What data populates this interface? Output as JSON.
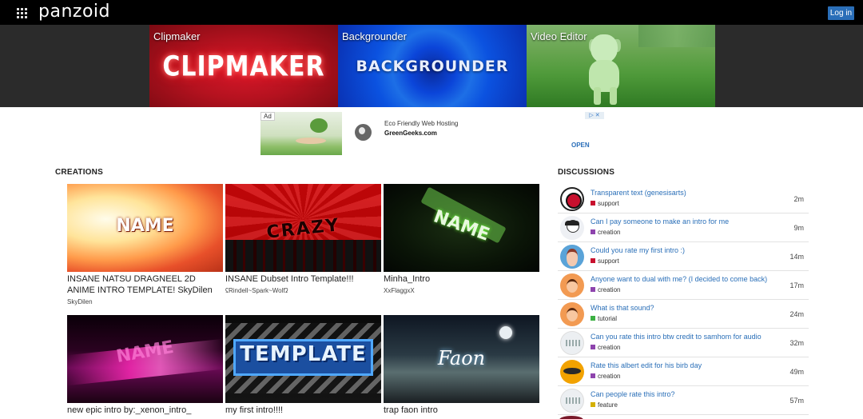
{
  "header": {
    "logo": "panzoid",
    "login_label": "Log in"
  },
  "hero": {
    "tiles": [
      {
        "label": "Clipmaker",
        "art_text": "CLIPMAKER"
      },
      {
        "label": "Backgrounder",
        "art_text": "BACKGROUNDER"
      },
      {
        "label": "Video Editor"
      }
    ]
  },
  "ad": {
    "badge": "Ad",
    "title": "Eco Friendly Web Hosting",
    "domain": "GreenGeeks.com",
    "cta": "OPEN",
    "choices": "▷ ✕"
  },
  "creations": {
    "heading": "CREATIONS",
    "items": [
      {
        "title": "INSANE NATSU DRAGNEEL 2D ANIME INTRO TEMPLATE! SkyDilen",
        "author": "SkyDilen",
        "art_text": "NAME"
      },
      {
        "title": "INSANE Dubset Intro Template!!!",
        "author": "ʢRindell~Spark~Wolfʡ",
        "art_text": "CRAZY"
      },
      {
        "title": "Minha_Intro",
        "author": "XxFlaggxX",
        "art_text": "NAME"
      },
      {
        "title": "new epic intro by:_xenon_intro_",
        "author": "",
        "art_text": "NAME"
      },
      {
        "title": "my first intro!!!!",
        "author": "",
        "art_text": "TEMPLATE"
      },
      {
        "title": "trap faon intro",
        "author": "",
        "art_text": "Faon"
      }
    ]
  },
  "discussions": {
    "heading": "DISCUSSIONS",
    "items": [
      {
        "title": "Transparent text (genesisarts)",
        "category": "support",
        "time": "2m",
        "color": "#c8102e"
      },
      {
        "title": "Can I pay someone to make an intro for me",
        "category": "creation",
        "time": "9m",
        "color": "#8e44ad"
      },
      {
        "title": "Could you rate my first intro :)",
        "category": "support",
        "time": "14m",
        "color": "#c8102e"
      },
      {
        "title": "Anyone want to dual with me? (I decided to come back)",
        "category": "creation",
        "time": "17m",
        "color": "#8e44ad"
      },
      {
        "title": "What is that sound?",
        "category": "tutorial",
        "time": "24m",
        "color": "#3cb043"
      },
      {
        "title": "Can you rate this intro btw credit to samhom for audio",
        "category": "creation",
        "time": "32m",
        "color": "#8e44ad"
      },
      {
        "title": "Rate this albert edit for his birb day",
        "category": "creation",
        "time": "49m",
        "color": "#8e44ad"
      },
      {
        "title": "Can people rate this intro?",
        "category": "feature",
        "time": "57m",
        "color": "#d4b000"
      }
    ]
  }
}
